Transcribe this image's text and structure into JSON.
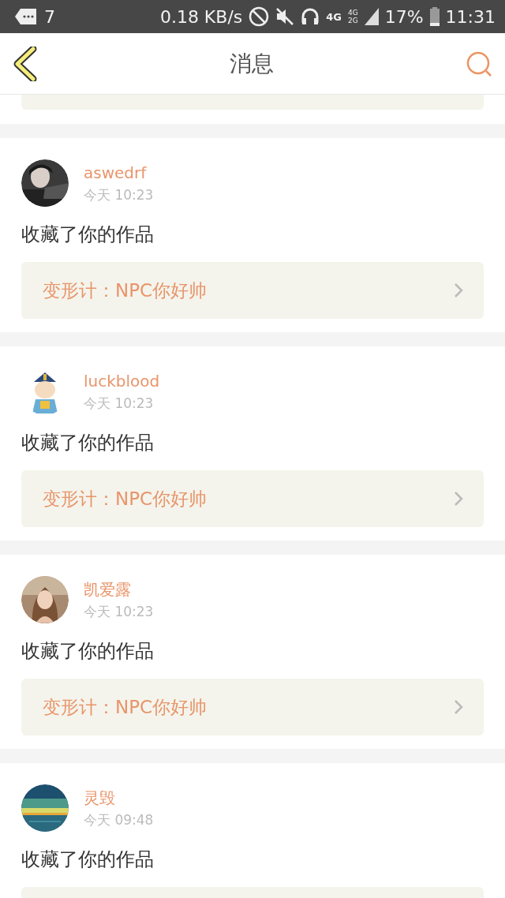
{
  "status_bar": {
    "notification_count": "7",
    "speed": "0.18 KB/s",
    "network": "4G",
    "signal_labels": [
      "4G",
      "2G"
    ],
    "battery": "17%",
    "time": "11:31"
  },
  "header": {
    "title": "消息"
  },
  "messages": [
    {
      "user": "aswedrf",
      "time": "今天 10:23",
      "text": "收藏了你的作品",
      "link": "变形计：NPC你好帅"
    },
    {
      "user": "luckblood",
      "time": "今天 10:23",
      "text": "收藏了你的作品",
      "link": "变形计：NPC你好帅"
    },
    {
      "user": "凯爱露",
      "time": "今天 10:23",
      "text": "收藏了你的作品",
      "link": "变形计：NPC你好帅"
    },
    {
      "user": "灵毁",
      "time": "今天 09:48",
      "text": "收藏了你的作品"
    }
  ]
}
